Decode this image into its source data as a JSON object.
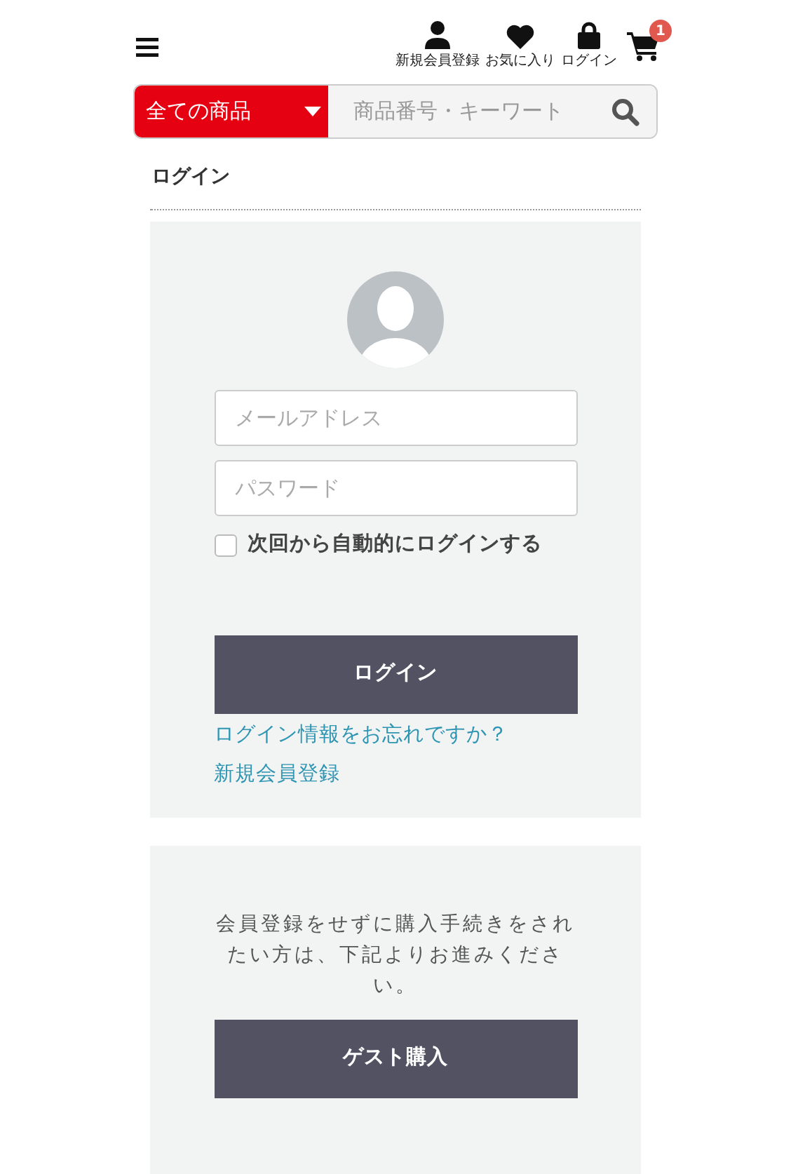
{
  "header": {
    "icons": [
      {
        "kind": "user",
        "label": "新規会員登録"
      },
      {
        "kind": "heart",
        "label": "お気に入り"
      },
      {
        "kind": "lock",
        "label": "ログイン"
      }
    ],
    "cart": {
      "count": "1"
    }
  },
  "search": {
    "category": "全ての商品",
    "placeholder": "商品番号・キーワート"
  },
  "page_title": "ログイン",
  "login": {
    "email_placeholder": "メールアドレス",
    "password_placeholder": "パスワード",
    "remember": {
      "label": "次回から自動的にログインする",
      "checked": false
    },
    "button": "ログイン",
    "links": [
      "ログイン情報をお忘れですか？",
      "新規会員登録"
    ]
  },
  "guest": {
    "text": "会員登録をせずに購入手続きをされたい方は、下記よりお進みください。",
    "button": "ゲスト購入"
  }
}
